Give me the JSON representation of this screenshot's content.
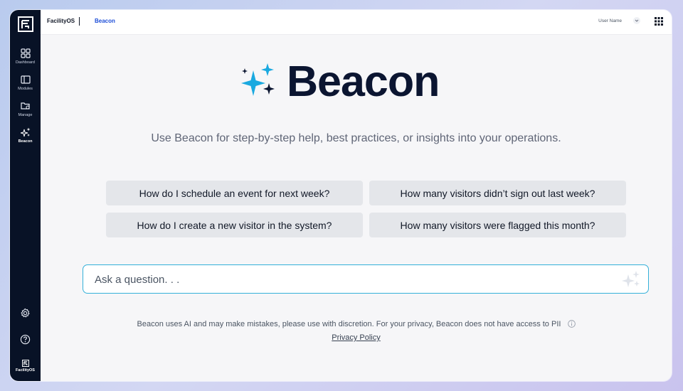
{
  "topbar": {
    "brand": "FacilityOS",
    "breadcrumb": "Beacon",
    "user_name": "User Name"
  },
  "sidebar": {
    "items": [
      {
        "label": "Dashboard",
        "icon": "dashboard-grid-icon"
      },
      {
        "label": "Modules",
        "icon": "modules-window-icon"
      },
      {
        "label": "Manage",
        "icon": "manage-folder-gear-icon"
      },
      {
        "label": "Beacon",
        "icon": "sparkle-icon",
        "active": true
      }
    ],
    "bottom": [
      {
        "icon": "settings-gear-icon"
      },
      {
        "icon": "help-circle-icon"
      }
    ],
    "brand_label": "FacilityOS"
  },
  "hero": {
    "title": "Beacon",
    "subtitle": "Use Beacon for step-by-step help, best practices, or insights into your operations."
  },
  "suggestions": [
    "How do I schedule an event for next week?",
    "How many visitors didn’t sign out last week?",
    "How do I create a new visitor in the system?",
    "How many visitors were flagged this month?"
  ],
  "ask": {
    "placeholder": "Ask a question. . .",
    "value": ""
  },
  "disclaimer": "Beacon uses AI and may make mistakes, please use with discretion. For your privacy, Beacon does not have access to PII",
  "privacy_link": "Privacy Policy",
  "colors": {
    "sidebar_bg": "#081226",
    "accent": "#1aa9e0",
    "title": "#0b1531",
    "input_border": "#34b0d9"
  }
}
